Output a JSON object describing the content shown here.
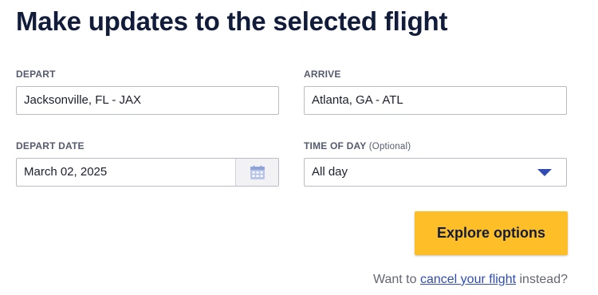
{
  "page": {
    "title": "Make updates to the selected flight"
  },
  "form": {
    "depart": {
      "label": "DEPART",
      "value": "Jacksonville, FL - JAX"
    },
    "arrive": {
      "label": "ARRIVE",
      "value": "Atlanta, GA - ATL"
    },
    "depart_date": {
      "label": "DEPART DATE",
      "value": "March 02, 2025",
      "icon": "calendar-icon"
    },
    "time_of_day": {
      "label": "TIME OF DAY",
      "optional": "(Optional)",
      "value": "All day",
      "icon": "chevron-down-icon"
    }
  },
  "actions": {
    "explore_label": "Explore options"
  },
  "footer": {
    "prefix": "Want to",
    "link": "cancel your flight",
    "suffix": "instead?"
  },
  "colors": {
    "title": "#111b3a",
    "accent_blue": "#304cb2",
    "button_yellow": "#fdbe28"
  }
}
